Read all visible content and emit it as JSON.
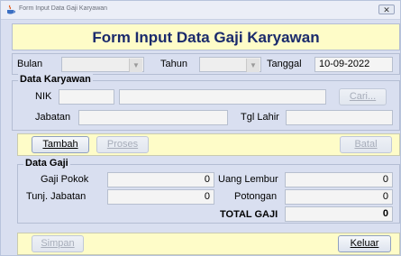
{
  "window": {
    "title": "Form Input Data Gaji Karyawan",
    "close_label": "✕",
    "icon": "java-cup-icon"
  },
  "header": {
    "title": "Form Input Data Gaji Karyawan"
  },
  "period": {
    "bulan_label": "Bulan",
    "bulan_value": "",
    "tahun_label": "Tahun",
    "tahun_value": "",
    "tanggal_label": "Tanggal",
    "tanggal_value": "10-09-2022"
  },
  "data_karyawan": {
    "group_label": "Data Karyawan",
    "nik_label": "NIK",
    "nik_value": "",
    "nama_value": "",
    "cari_label": "Cari...",
    "jabatan_label": "Jabatan",
    "jabatan_value": "",
    "tgl_lahir_label": "Tgl Lahir",
    "tgl_lahir_value": ""
  },
  "actions": {
    "tambah_label": "Tambah",
    "proses_label": "Proses",
    "batal_label": "Batal"
  },
  "data_gaji": {
    "group_label": "Data Gaji",
    "gaji_pokok_label": "Gaji Pokok",
    "gaji_pokok_value": "0",
    "tunj_jabatan_label": "Tunj. Jabatan",
    "tunj_jabatan_value": "0",
    "uang_lembur_label": "Uang Lembur",
    "uang_lembur_value": "0",
    "potongan_label": "Potongan",
    "potongan_value": "0",
    "total_label": "TOTAL GAJI",
    "total_value": "0"
  },
  "footer": {
    "simpan_label": "Simpan",
    "keluar_label": "Keluar"
  }
}
